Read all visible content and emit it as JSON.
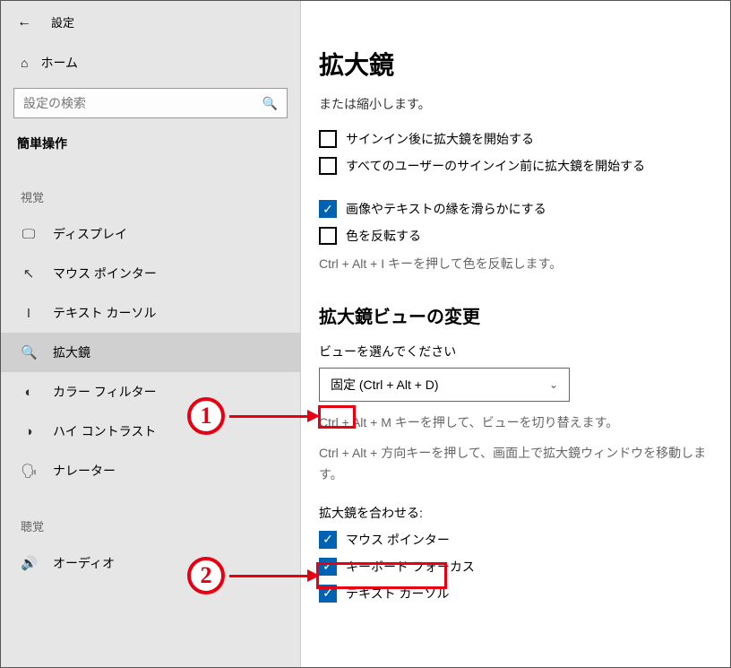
{
  "header": {
    "back": "←",
    "title": "設定"
  },
  "home": {
    "label": "ホーム"
  },
  "search": {
    "placeholder": "設定の検索"
  },
  "category": "簡単操作",
  "groups": {
    "visual": "視覚",
    "hearing": "聴覚"
  },
  "nav": {
    "display": "ディスプレイ",
    "mousePointer": "マウス ポインター",
    "textCursor": "テキスト カーソル",
    "magnifier": "拡大鏡",
    "colorFilter": "カラー フィルター",
    "highContrast": "ハイ コントラスト",
    "narrator": "ナレーター",
    "audio": "オーディオ"
  },
  "page": {
    "title": "拡大鏡",
    "zoomDesc": "または縮小します。",
    "cbStartAfterSignin": "サインイン後に拡大鏡を開始する",
    "cbStartBeforeSignin": "すべてのユーザーのサインイン前に拡大鏡を開始する",
    "cbSmoothEdges": "画像やテキストの縁を滑らかにする",
    "cbInvertColors": "色を反転する",
    "invertHint": "Ctrl + Alt + I キーを押して色を反転します。",
    "sectionViewTitle": "拡大鏡ビューの変更",
    "viewSelectLabel": "ビューを選んでください",
    "viewSelectValue": "固定 (Ctrl + Alt + D)",
    "viewSwitchHint": "Ctrl + Alt + M キーを押して、ビューを切り替えます。",
    "viewMoveHint": "Ctrl + Alt + 方向キーを押して、画面上で拡大鏡ウィンドウを移動します。",
    "followLabel": "拡大鏡を合わせる:",
    "cbFollowMouse": "マウス ポインター",
    "cbFollowKeyboard": "キーボード フォーカス",
    "cbFollowTextCursor": "テキスト カーソル"
  },
  "annotations": {
    "one": "1",
    "two": "2"
  }
}
